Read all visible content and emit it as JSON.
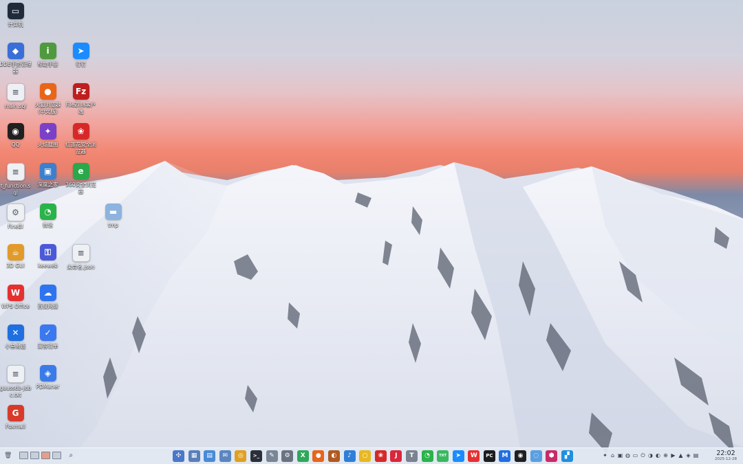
{
  "desktop": {
    "icons": [
      {
        "label": "计算机",
        "glyph": "▭",
        "color": "#1f2b3a",
        "icon": "computer-icon"
      },
      {
        "label": "DDE手势管理器",
        "glyph": "◆",
        "color": "#3a6fd8",
        "icon": "gesture-manager-icon"
      },
      {
        "label": "帮助手册",
        "glyph": "i",
        "color": "#4f9a3c",
        "icon": "help-manual-icon"
      },
      {
        "label": "钉钉",
        "glyph": "➤",
        "color": "#1a8cff",
        "icon": "dingtalk-icon"
      },
      {
        "label": "main.sql",
        "glyph": "≡",
        "color": "#eef0f3",
        "icon": "document-icon"
      },
      {
        "label": "火狐浏览器（中文版）",
        "glyph": "●",
        "color": "#e8651a",
        "icon": "firefox-icon"
      },
      {
        "label": "FileZilla客户端",
        "glyph": "Fz",
        "color": "#bf1e1e",
        "icon": "filezilla-icon"
      },
      {
        "label": "QQ",
        "glyph": "◉",
        "color": "#202020",
        "icon": "qq-penguin-icon"
      },
      {
        "label": "火焰截图",
        "glyph": "✦",
        "color": "#7b3fc8",
        "icon": "flameshot-icon"
      },
      {
        "label": "红莲花安全浏览器",
        "glyph": "❀",
        "color": "#d62828",
        "icon": "lotus-browser-icon"
      },
      {
        "label": "t_function.sql",
        "glyph": "≡",
        "color": "#eef0f3",
        "icon": "document-icon"
      },
      {
        "label": "深度之家",
        "glyph": "▣",
        "color": "#3c7fcf",
        "icon": "deepin-home-icon"
      },
      {
        "label": "360安全浏览器",
        "glyph": "e",
        "color": "#2aa84a",
        "icon": "360-browser-icon"
      },
      {
        "label": "FineBI",
        "glyph": "⚙",
        "color": "#eef0f3",
        "icon": "finebi-icon"
      },
      {
        "label": "微信",
        "glyph": "◔",
        "color": "#2ab34a",
        "icon": "wechat-icon"
      },
      {
        "label": "tmp",
        "glyph": "▬",
        "color": "#8db3df",
        "icon": "folder-icon"
      },
      {
        "label": "3D GUI",
        "glyph": "☕",
        "color": "#e29a2a",
        "icon": "coffee-cup-icon"
      },
      {
        "label": "keeweb",
        "glyph": "⚿",
        "color": "#4a5ad8",
        "icon": "keeweb-icon"
      },
      {
        "label": "未命名.json",
        "glyph": "≡",
        "color": "#eef0f3",
        "icon": "document-icon"
      },
      {
        "label": "WPS Office",
        "glyph": "W",
        "color": "#e63030",
        "icon": "wps-office-icon"
      },
      {
        "label": "百度网盘",
        "glyph": "☁",
        "color": "#2e74f0",
        "icon": "baidu-netdisk-icon"
      },
      {
        "label": "小鱼易连",
        "glyph": "✕",
        "color": "#1f6fe0",
        "icon": "xiaoyu-icon"
      },
      {
        "label": "滴答清单",
        "glyph": "✓",
        "color": "#3b78f0",
        "icon": "ticktick-icon"
      },
      {
        "label": "gaussdb-jdbc.txt",
        "glyph": "≡",
        "color": "#eef0f3",
        "icon": "text-file-icon"
      },
      {
        "label": "PDManer",
        "glyph": "◈",
        "color": "#3a7be8",
        "icon": "pdmaner-icon"
      },
      {
        "label": "Foxmail",
        "glyph": "G",
        "color": "#d83a2a",
        "icon": "foxmail-icon"
      }
    ]
  },
  "taskbar": {
    "apps": [
      {
        "name": "launcher",
        "glyph": "✣",
        "color": "#4a78c8"
      },
      {
        "name": "multitask-view",
        "glyph": "▦",
        "color": "#5a7fb8"
      },
      {
        "name": "file-manager",
        "glyph": "▤",
        "color": "#4a8ad8"
      },
      {
        "name": "mail",
        "glyph": "✉",
        "color": "#5b86c0"
      },
      {
        "name": "chrome",
        "glyph": "◎",
        "color": "#e0a020"
      },
      {
        "name": "terminal",
        "glyph": ">_",
        "color": "#2a2f3a"
      },
      {
        "name": "text-editor",
        "glyph": "✎",
        "color": "#7a8596"
      },
      {
        "name": "settings",
        "glyph": "⚙",
        "color": "#6a7380"
      },
      {
        "name": "xmind",
        "glyph": "X",
        "color": "#2fa85a"
      },
      {
        "name": "firefox",
        "glyph": "●",
        "color": "#e8651a"
      },
      {
        "name": "browser",
        "glyph": "◐",
        "color": "#b05a20"
      },
      {
        "name": "douyin",
        "glyph": "♪",
        "color": "#2f7fd8"
      },
      {
        "name": "ring-app",
        "glyph": "○",
        "color": "#e8b820"
      },
      {
        "name": "lotus-browser",
        "glyph": "❀",
        "color": "#d62828"
      },
      {
        "name": "jetbrains",
        "glyph": "J",
        "color": "#d8283a"
      },
      {
        "name": "typora",
        "glyph": "T",
        "color": "#7a8290"
      },
      {
        "name": "wechat",
        "glyph": "◔",
        "color": "#2ab34a"
      },
      {
        "name": "txt-editor",
        "glyph": "TXT",
        "color": "#3ab860"
      },
      {
        "name": "dingtalk",
        "glyph": "➤",
        "color": "#1a8cff"
      },
      {
        "name": "wps",
        "glyph": "W",
        "color": "#e63030"
      },
      {
        "name": "pycharm",
        "glyph": "PC",
        "color": "#1d1d1d"
      },
      {
        "name": "kingsoft",
        "glyph": "M",
        "color": "#1f6fe0"
      },
      {
        "name": "qq",
        "glyph": "◉",
        "color": "#202020"
      },
      {
        "name": "chat-app",
        "glyph": "◌",
        "color": "#5a9fe0"
      },
      {
        "name": "dev-tool",
        "glyph": "⬢",
        "color": "#c82a6a"
      },
      {
        "name": "app-store",
        "glyph": "▞",
        "color": "#1f8fe0"
      }
    ],
    "tray_icons": [
      "✦",
      "⌂",
      "▣",
      "◍",
      "▭",
      "⏻",
      "◑",
      "◐",
      "⊕",
      "▶",
      "▲",
      "◈",
      "▤"
    ],
    "clock_time": "22:02",
    "clock_date": "2025-12-28"
  }
}
